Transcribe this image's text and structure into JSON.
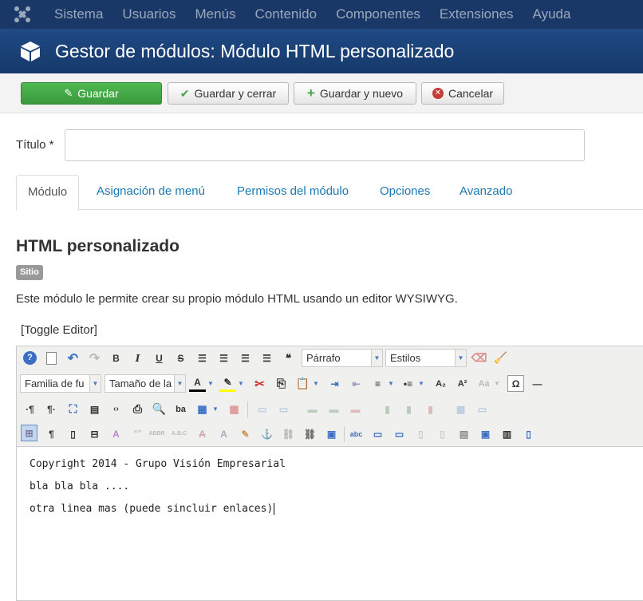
{
  "topnav": {
    "items": [
      "Sistema",
      "Usuarios",
      "Menús",
      "Contenido",
      "Componentes",
      "Extensiones",
      "Ayuda"
    ]
  },
  "header": {
    "title": "Gestor de módulos: Módulo HTML personalizado",
    "icon": "cube-icon"
  },
  "toolbar": {
    "save": "Guardar",
    "save_close": "Guardar y cerrar",
    "save_new": "Guardar y nuevo",
    "cancel": "Cancelar",
    "accent": "#46a546"
  },
  "form": {
    "title_label": "Título *",
    "title_value": ""
  },
  "tabs": [
    "Módulo",
    "Asignación de menú",
    "Permisos del módulo",
    "Opciones",
    "Avanzado"
  ],
  "module": {
    "title": "HTML personalizado",
    "badge": "Sitio",
    "description": "Este módulo le permite crear su propio módulo HTML usando un editor WYSIWYG."
  },
  "editor": {
    "toggle": "[Toggle Editor]",
    "format_select": "Párrafo",
    "styles_select": "Estilos",
    "font_family_select": "Familia de fu",
    "font_size_select": "Tamaño de la",
    "content": [
      "Copyright 2014 - Grupo Visión Empresarial",
      "bla bla bla ....",
      "otra linea mas (puede sincluir enlaces)"
    ]
  }
}
